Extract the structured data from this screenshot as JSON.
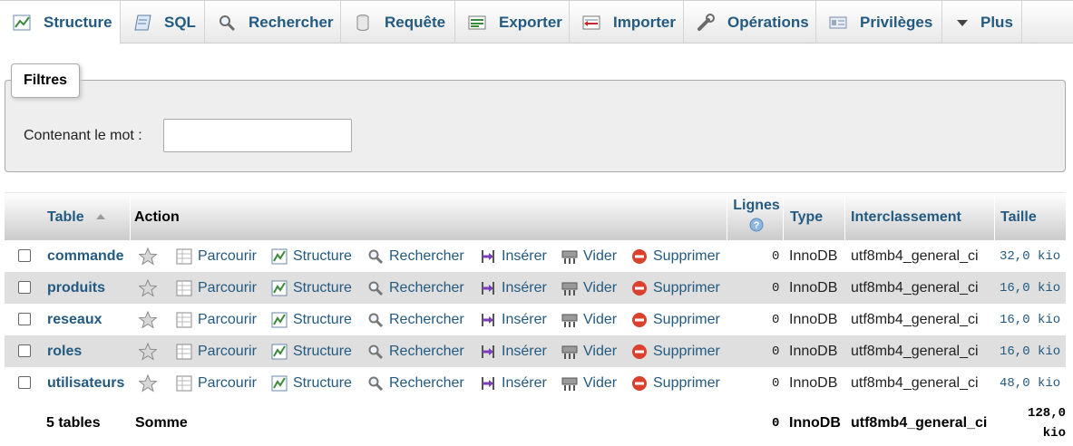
{
  "tabs": [
    {
      "id": "structure",
      "label": "Structure",
      "icon": "structure-icon"
    },
    {
      "id": "sql",
      "label": "SQL",
      "icon": "sql-icon"
    },
    {
      "id": "search",
      "label": "Rechercher",
      "icon": "search-icon"
    },
    {
      "id": "query",
      "label": "Requête",
      "icon": "query-icon"
    },
    {
      "id": "export",
      "label": "Exporter",
      "icon": "export-icon"
    },
    {
      "id": "import",
      "label": "Importer",
      "icon": "import-icon"
    },
    {
      "id": "operations",
      "label": "Opérations",
      "icon": "wrench-icon"
    },
    {
      "id": "privileges",
      "label": "Privilèges",
      "icon": "privileges-icon"
    },
    {
      "id": "more",
      "label": "Plus",
      "icon": "caret-down-icon"
    }
  ],
  "filters": {
    "legend": "Filtres",
    "label": "Contenant le mot :",
    "value": "",
    "placeholder": ""
  },
  "table_headers": {
    "table": "Table",
    "action": "Action",
    "rows": "Lignes",
    "type": "Type",
    "collation": "Interclassement",
    "size": "Taille"
  },
  "actions": {
    "browse": "Parcourir",
    "structure": "Structure",
    "search": "Rechercher",
    "insert": "Insérer",
    "empty": "Vider",
    "drop": "Supprimer"
  },
  "rows": [
    {
      "name": "commande",
      "rows": "0",
      "type": "InnoDB",
      "collation": "utf8mb4_general_ci",
      "size": "32,0 kio"
    },
    {
      "name": "produits",
      "rows": "0",
      "type": "InnoDB",
      "collation": "utf8mb4_general_ci",
      "size": "16,0 kio"
    },
    {
      "name": "reseaux",
      "rows": "0",
      "type": "InnoDB",
      "collation": "utf8mb4_general_ci",
      "size": "16,0 kio"
    },
    {
      "name": "roles",
      "rows": "0",
      "type": "InnoDB",
      "collation": "utf8mb4_general_ci",
      "size": "16,0 kio"
    },
    {
      "name": "utilisateurs",
      "rows": "0",
      "type": "InnoDB",
      "collation": "utf8mb4_general_ci",
      "size": "48,0 kio"
    }
  ],
  "footer": {
    "count": "5 tables",
    "sum_label": "Somme",
    "rows": "0",
    "type": "InnoDB",
    "collation": "utf8mb4_general_ci",
    "size_line1": "128,0",
    "size_line2": "kio"
  },
  "colors": {
    "link": "#235a81",
    "row_alt": "#dfdfdf",
    "drop_red": "#d9412e"
  }
}
